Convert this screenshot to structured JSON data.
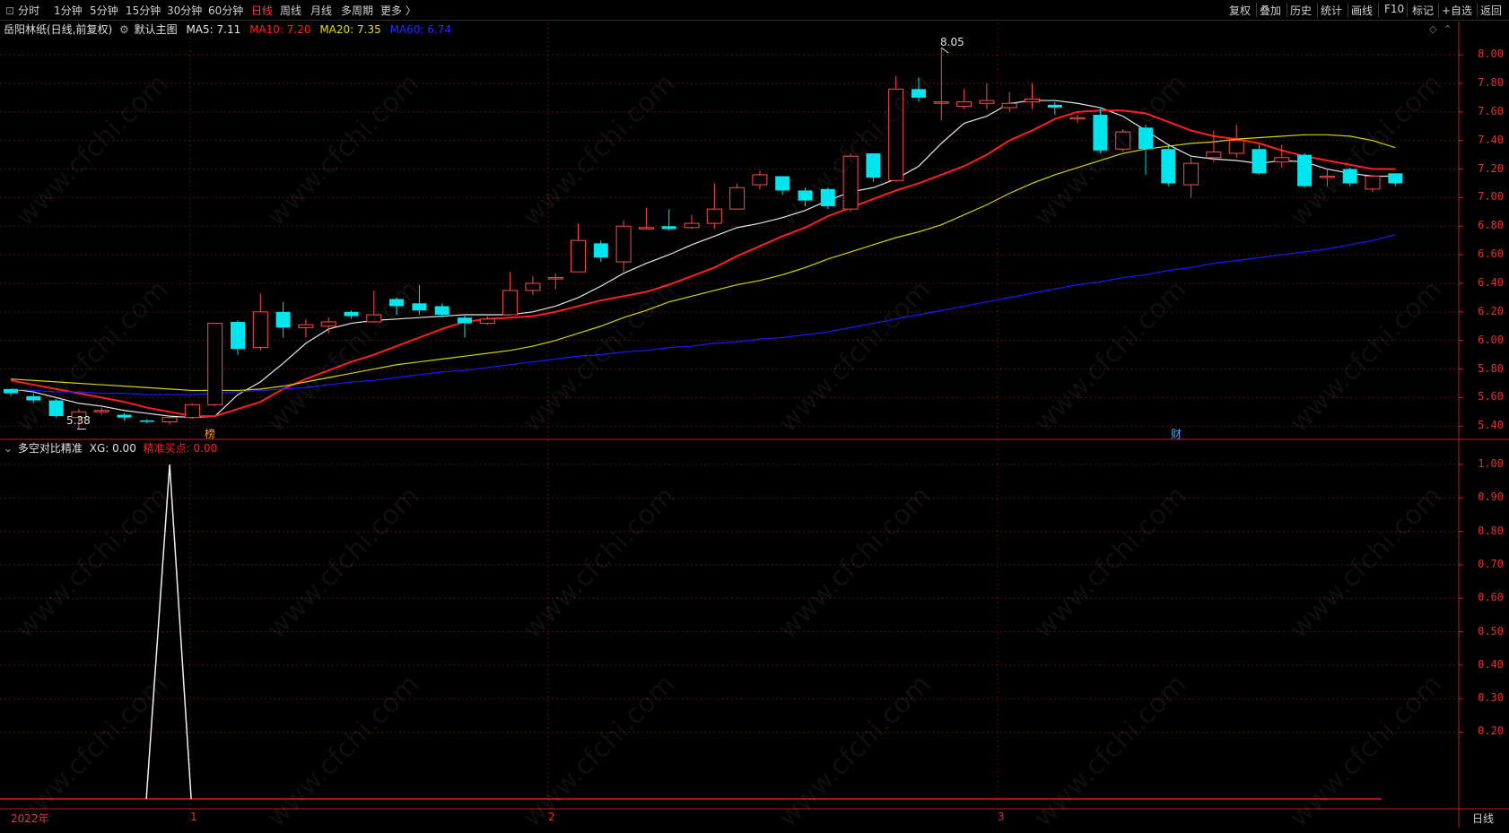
{
  "toolbar": {
    "periods": [
      "分时",
      "1分钟",
      "5分钟",
      "15分钟",
      "30分钟",
      "60分钟",
      "日线",
      "周线",
      "月线",
      "多周期",
      "更多 〉"
    ],
    "active_period": "日线",
    "right_buttons": [
      "复权",
      "叠加",
      "历史",
      "统计",
      "画线",
      "F10",
      "标记",
      "+自选",
      "返回"
    ]
  },
  "main_legend": {
    "stock": "岳阳林纸(日线,前复权)",
    "template": "默认主图",
    "ma5": "MA5: 7.11",
    "ma10": "MA10: 7.20",
    "ma20": "MA20: 7.35",
    "ma60": "MA60: 6.74"
  },
  "sub_legend": {
    "name": "多空对比精准",
    "xg": "XG: 0.00",
    "buy": "精准买点: 0.00"
  },
  "markers": {
    "high": "8.05",
    "low": "5.38",
    "bang": "榜",
    "cai": "财"
  },
  "x_labels": [
    "2022年",
    "1",
    "2",
    "3"
  ],
  "period_label": "日线",
  "watermark": "www.cfchi.com",
  "colors": {
    "up": "#ff4d4d",
    "down": "#00e5ee",
    "ma5": "#e6e6e6",
    "ma10": "#ff2020",
    "ma20": "#d4d400",
    "ma60": "#1a1aff",
    "axis": "#c81e1e"
  },
  "chart_data": [
    {
      "type": "candlestick",
      "title": "岳阳林纸(日线,前复权)",
      "y_ticks": [
        "8.00",
        "7.80",
        "7.60",
        "7.40",
        "7.20",
        "7.00",
        "6.80",
        "6.60",
        "6.40",
        "6.20",
        "6.00",
        "5.80",
        "5.60",
        "5.40"
      ],
      "ylim": [
        5.32,
        8.12
      ],
      "candles": [
        [
          5.66,
          5.63,
          5.66,
          5.61
        ],
        [
          5.61,
          5.58,
          5.63,
          5.56
        ],
        [
          5.58,
          5.47,
          5.59,
          5.46
        ],
        [
          5.46,
          5.5,
          5.52,
          5.38
        ],
        [
          5.5,
          5.51,
          5.53,
          5.48
        ],
        [
          5.48,
          5.46,
          5.49,
          5.44
        ],
        [
          5.44,
          5.43,
          5.45,
          5.42
        ],
        [
          5.43,
          5.46,
          5.47,
          5.41
        ],
        [
          5.46,
          5.55,
          5.56,
          5.45
        ],
        [
          5.55,
          6.12,
          6.12,
          5.54
        ],
        [
          6.13,
          5.94,
          6.14,
          5.9
        ],
        [
          5.95,
          6.2,
          6.33,
          5.93
        ],
        [
          6.2,
          6.09,
          6.27,
          6.02
        ],
        [
          6.09,
          6.11,
          6.15,
          6.02
        ],
        [
          6.1,
          6.13,
          6.16,
          6.05
        ],
        [
          6.2,
          6.17,
          6.21,
          6.15
        ],
        [
          6.13,
          6.18,
          6.35,
          6.13
        ],
        [
          6.29,
          6.24,
          6.3,
          6.18
        ],
        [
          6.26,
          6.21,
          6.39,
          6.18
        ],
        [
          6.24,
          6.18,
          6.26,
          6.16
        ],
        [
          6.16,
          6.12,
          6.18,
          6.02
        ],
        [
          6.12,
          6.15,
          6.17,
          6.11
        ],
        [
          6.18,
          6.35,
          6.48,
          6.18
        ],
        [
          6.35,
          6.4,
          6.45,
          6.32
        ],
        [
          6.44,
          6.44,
          6.47,
          6.36
        ],
        [
          6.48,
          6.7,
          6.82,
          6.48
        ],
        [
          6.68,
          6.58,
          6.7,
          6.55
        ],
        [
          6.55,
          6.8,
          6.84,
          6.48
        ],
        [
          6.79,
          6.79,
          6.93,
          6.79
        ],
        [
          6.8,
          6.78,
          6.92,
          6.77
        ],
        [
          6.79,
          6.82,
          6.88,
          6.78
        ],
        [
          6.82,
          6.92,
          7.1,
          6.78
        ],
        [
          6.92,
          7.07,
          7.1,
          6.92
        ],
        [
          7.09,
          7.16,
          7.19,
          7.06
        ],
        [
          7.15,
          7.05,
          7.15,
          7.02
        ],
        [
          7.05,
          6.98,
          7.07,
          6.94
        ],
        [
          7.06,
          6.94,
          7.07,
          6.92
        ],
        [
          6.92,
          7.29,
          7.31,
          6.9
        ],
        [
          7.31,
          7.14,
          7.31,
          7.11
        ],
        [
          7.12,
          7.76,
          7.85,
          7.11
        ],
        [
          7.76,
          7.7,
          7.84,
          7.67
        ],
        [
          7.67,
          7.67,
          8.05,
          7.54
        ],
        [
          7.64,
          7.67,
          7.76,
          7.62
        ],
        [
          7.66,
          7.68,
          7.8,
          7.62
        ],
        [
          7.63,
          7.66,
          7.74,
          7.6
        ],
        [
          7.67,
          7.69,
          7.8,
          7.62
        ],
        [
          7.65,
          7.63,
          7.67,
          7.58
        ],
        [
          7.56,
          7.56,
          7.58,
          7.52
        ],
        [
          7.58,
          7.33,
          7.63,
          7.31
        ],
        [
          7.34,
          7.46,
          7.48,
          7.32
        ],
        [
          7.49,
          7.34,
          7.51,
          7.16
        ],
        [
          7.34,
          7.1,
          7.36,
          7.08
        ],
        [
          7.09,
          7.24,
          7.28,
          7.0
        ],
        [
          7.28,
          7.32,
          7.47,
          7.25
        ],
        [
          7.31,
          7.4,
          7.51,
          7.28
        ],
        [
          7.34,
          7.17,
          7.37,
          7.16
        ],
        [
          7.25,
          7.28,
          7.37,
          7.21
        ],
        [
          7.3,
          7.08,
          7.31,
          7.07
        ],
        [
          7.15,
          7.15,
          7.2,
          7.08
        ],
        [
          7.2,
          7.1,
          7.21,
          7.08
        ],
        [
          7.06,
          7.15,
          7.16,
          7.04
        ],
        [
          7.17,
          7.1,
          7.17,
          7.08
        ]
      ],
      "series": [
        {
          "name": "MA5",
          "values": [
            5.66,
            5.64,
            5.6,
            5.56,
            5.54,
            5.51,
            5.49,
            5.47,
            5.46,
            5.47,
            5.62,
            5.71,
            5.84,
            5.98,
            6.08,
            6.12,
            6.14,
            6.15,
            6.16,
            6.17,
            6.18,
            6.18,
            6.18,
            6.2,
            6.24,
            6.3,
            6.38,
            6.47,
            6.54,
            6.6,
            6.67,
            6.73,
            6.79,
            6.82,
            6.86,
            6.91,
            6.98,
            7.04,
            7.07,
            7.13,
            7.22,
            7.38,
            7.52,
            7.57,
            7.66,
            7.68,
            7.68,
            7.66,
            7.63,
            7.57,
            7.47,
            7.37,
            7.29,
            7.27,
            7.26,
            7.24,
            7.26,
            7.25,
            7.2,
            7.17,
            7.15,
            7.15
          ]
        },
        {
          "name": "MA10",
          "values": [
            5.72,
            5.69,
            5.66,
            5.63,
            5.6,
            5.57,
            5.53,
            5.5,
            5.47,
            5.47,
            5.52,
            5.57,
            5.66,
            5.73,
            5.79,
            5.85,
            5.9,
            5.96,
            6.02,
            6.08,
            6.13,
            6.15,
            6.16,
            6.17,
            6.2,
            6.24,
            6.28,
            6.31,
            6.34,
            6.39,
            6.45,
            6.51,
            6.59,
            6.66,
            6.73,
            6.79,
            6.87,
            6.93,
            6.99,
            7.05,
            7.1,
            7.16,
            7.22,
            7.3,
            7.4,
            7.47,
            7.55,
            7.6,
            7.61,
            7.61,
            7.59,
            7.53,
            7.47,
            7.43,
            7.41,
            7.38,
            7.33,
            7.29,
            7.26,
            7.23,
            7.2,
            7.2
          ]
        },
        {
          "name": "MA20",
          "values": [
            5.73,
            5.72,
            5.71,
            5.7,
            5.69,
            5.68,
            5.67,
            5.66,
            5.65,
            5.65,
            5.65,
            5.66,
            5.68,
            5.71,
            5.74,
            5.77,
            5.8,
            5.83,
            5.85,
            5.87,
            5.89,
            5.91,
            5.93,
            5.96,
            6.0,
            6.05,
            6.1,
            6.16,
            6.21,
            6.27,
            6.31,
            6.35,
            6.39,
            6.42,
            6.46,
            6.51,
            6.57,
            6.62,
            6.67,
            6.72,
            6.76,
            6.81,
            6.88,
            6.95,
            7.03,
            7.1,
            7.16,
            7.21,
            7.26,
            7.31,
            7.34,
            7.36,
            7.38,
            7.39,
            7.41,
            7.42,
            7.43,
            7.44,
            7.44,
            7.43,
            7.4,
            7.35
          ]
        },
        {
          "name": "MA60",
          "values": [
            5.66,
            5.65,
            5.64,
            5.64,
            5.63,
            5.63,
            5.62,
            5.62,
            5.62,
            5.63,
            5.64,
            5.65,
            5.66,
            5.67,
            5.69,
            5.71,
            5.72,
            5.74,
            5.76,
            5.78,
            5.79,
            5.81,
            5.83,
            5.85,
            5.87,
            5.89,
            5.9,
            5.92,
            5.93,
            5.95,
            5.96,
            5.98,
            5.99,
            6.01,
            6.02,
            6.04,
            6.06,
            6.09,
            6.12,
            6.15,
            6.18,
            6.21,
            6.24,
            6.27,
            6.3,
            6.33,
            6.36,
            6.39,
            6.41,
            6.44,
            6.46,
            6.49,
            6.51,
            6.54,
            6.56,
            6.58,
            6.6,
            6.62,
            6.64,
            6.67,
            6.7,
            6.74
          ]
        }
      ]
    },
    {
      "type": "line",
      "title": "多空对比精准",
      "y_ticks": [
        "1.00",
        "0.90",
        "0.80",
        "0.70",
        "0.60",
        "0.50",
        "0.40",
        "0.30",
        "0.20"
      ],
      "ylim": [
        0,
        1
      ],
      "series": [
        {
          "name": "XG",
          "values": [
            0,
            0,
            0,
            0,
            0,
            0,
            0,
            1,
            0,
            0,
            0,
            0,
            0,
            0,
            0,
            0,
            0,
            0,
            0,
            0,
            0,
            0,
            0,
            0,
            0,
            0,
            0,
            0,
            0,
            0,
            0,
            0,
            0,
            0,
            0,
            0,
            0,
            0,
            0,
            0,
            0,
            0,
            0,
            0,
            0,
            0,
            0,
            0,
            0,
            0,
            0,
            0,
            0,
            0,
            0,
            0,
            0,
            0,
            0,
            0,
            0,
            0
          ]
        }
      ]
    }
  ]
}
